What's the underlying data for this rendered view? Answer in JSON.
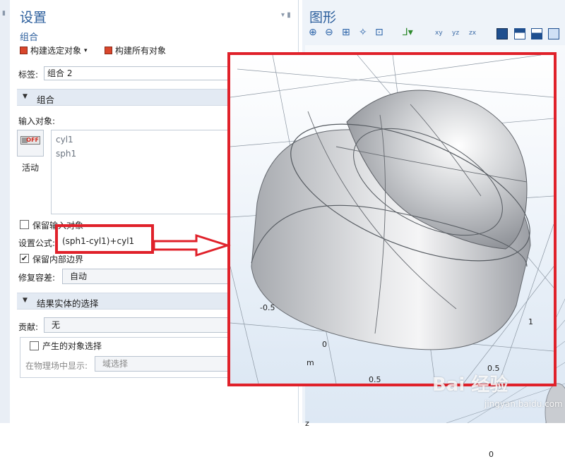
{
  "settings": {
    "title": "设置",
    "subtitle": "组合",
    "toolbar": {
      "build_selected": "构建选定对象",
      "build_all": "构建所有对象"
    },
    "label_caption": "标签:",
    "label_value": "组合 2",
    "section_combine": "组合",
    "input_objects_caption": "输入对象:",
    "input_objects": [
      "cyl1",
      "sph1"
    ],
    "active_caption": "活动",
    "active_switch": "OFF",
    "keep_input_label": "保留输入对象",
    "formula_caption": "设置公式:",
    "formula_value": "(sph1-cyl1)+cyl1",
    "keep_inner_label": "保留内部边界",
    "repair_caption": "修复容差:",
    "repair_value": "自动",
    "section_result": "结果实体的选择",
    "contribute_caption": "贡献:",
    "contribute_value": "无",
    "result_selection_label": "产生的对象选择",
    "physics_caption": "在物理场中显示:",
    "physics_value": "域选择"
  },
  "graphics": {
    "title": "图形",
    "tools": [
      "zoom-in-icon",
      "zoom-out-icon",
      "zoom-box-icon",
      "zoom-selected-icon",
      "zoom-extents-icon",
      "axes-icon",
      "view-xy-icon",
      "view-yz-icon",
      "view-zx-icon",
      "render-icon",
      "wireframe-icon",
      "transparency-icon",
      "hide-icon"
    ],
    "view_xy": "xy",
    "view_yz": "yz",
    "view_zx": "zx",
    "axis_labels": {
      "a": "-0.5",
      "b": "0",
      "c": "m",
      "d": "0.5",
      "e": "1",
      "f": "0.5",
      "g": "0",
      "h": "z"
    }
  },
  "watermark": {
    "brand": "Bai 经验",
    "url": "jingyan.baidu.com"
  },
  "colors": {
    "accent": "#2b5e9c",
    "callout": "#e0212a"
  }
}
